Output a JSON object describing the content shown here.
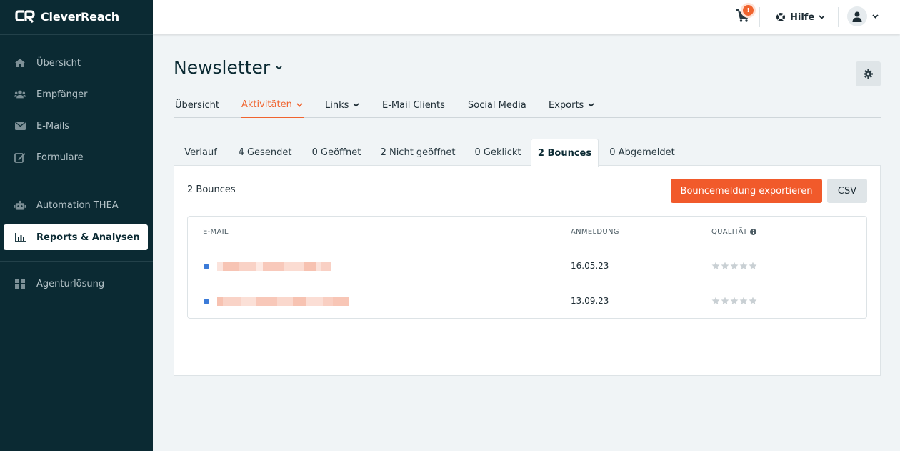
{
  "app": {
    "name": "CleverReach"
  },
  "sidebar": {
    "items": [
      {
        "label": "Übersicht",
        "icon": "home-icon"
      },
      {
        "label": "Empfänger",
        "icon": "users-icon"
      },
      {
        "label": "E-Mails",
        "icon": "envelope-icon"
      },
      {
        "label": "Formulare",
        "icon": "form-edit-icon"
      },
      {
        "label": "Automation THEA",
        "icon": "robot-icon"
      },
      {
        "label": "Reports & Analysen",
        "icon": "chart-bar-icon",
        "active": true
      },
      {
        "label": "Agenturlösung",
        "icon": "grid-icon"
      }
    ]
  },
  "topbar": {
    "cart_badge": "!",
    "help_label": "Hilfe"
  },
  "page": {
    "title": "Newsletter"
  },
  "nav": {
    "items": [
      {
        "label": "Übersicht"
      },
      {
        "label": "Aktivitäten",
        "active": true
      },
      {
        "label": "Links"
      },
      {
        "label": "E-Mail Clients"
      },
      {
        "label": "Social Media"
      },
      {
        "label": "Exports"
      }
    ]
  },
  "subtabs": {
    "items": [
      {
        "label": "Verlauf"
      },
      {
        "label": "4 Gesendet"
      },
      {
        "label": "0 Geöffnet"
      },
      {
        "label": "2 Nicht geöffnet"
      },
      {
        "label": "0 Geklickt"
      },
      {
        "label": "2 Bounces",
        "active": true
      },
      {
        "label": "0 Abgemeldet"
      }
    ]
  },
  "panel": {
    "count_label": "2 Bounces",
    "export_button": "Bouncemeldung exportieren",
    "csv_button": "CSV"
  },
  "table": {
    "columns": [
      "E-MAIL",
      "ANMELDUNG",
      "QUALITÄT"
    ],
    "rows": [
      {
        "date": "16.05.23",
        "quality_stars": 0
      },
      {
        "date": "13.09.23",
        "quality_stars": 0
      }
    ]
  },
  "colors": {
    "sidebar_bg": "#0b2a33",
    "accent": "#f15a2b",
    "status_dot": "#3b7bd8"
  }
}
